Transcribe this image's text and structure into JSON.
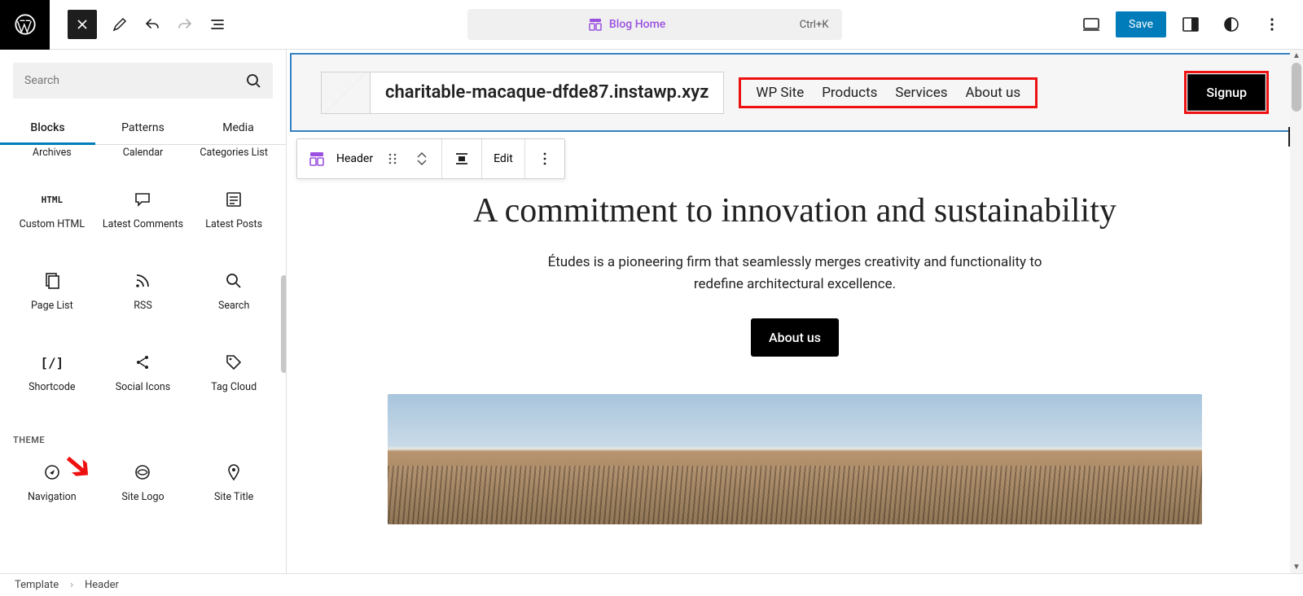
{
  "topbar": {
    "title": "Blog Home",
    "shortcut": "Ctrl+K",
    "save": "Save"
  },
  "inserter": {
    "search_placeholder": "Search",
    "tabs": {
      "blocks": "Blocks",
      "patterns": "Patterns",
      "media": "Media"
    },
    "items_row1": [
      "Archives",
      "Calendar",
      "Categories List"
    ],
    "items_row2": [
      "Custom HTML",
      "Latest Comments",
      "Latest Posts"
    ],
    "items_row3": [
      "Page List",
      "RSS",
      "Search"
    ],
    "items_row4": [
      "Shortcode",
      "Social Icons",
      "Tag Cloud"
    ],
    "theme_head": "THEME",
    "theme_row": [
      "Navigation",
      "Site Logo",
      "Site Title"
    ]
  },
  "block_toolbar": {
    "name": "Header",
    "edit": "Edit"
  },
  "header_block": {
    "site_title": "charitable-macaque-dfde87.instawp.xyz",
    "nav": [
      "WP Site",
      "Products",
      "Services",
      "About us"
    ],
    "signup": "Signup"
  },
  "hero": {
    "title": "A commitment to innovation and sustainability",
    "subtitle": "Études is a pioneering firm that seamlessly merges creativity and functionality to redefine architectural excellence.",
    "cta": "About us"
  },
  "breadcrumb": {
    "a": "Template",
    "b": "Header"
  }
}
